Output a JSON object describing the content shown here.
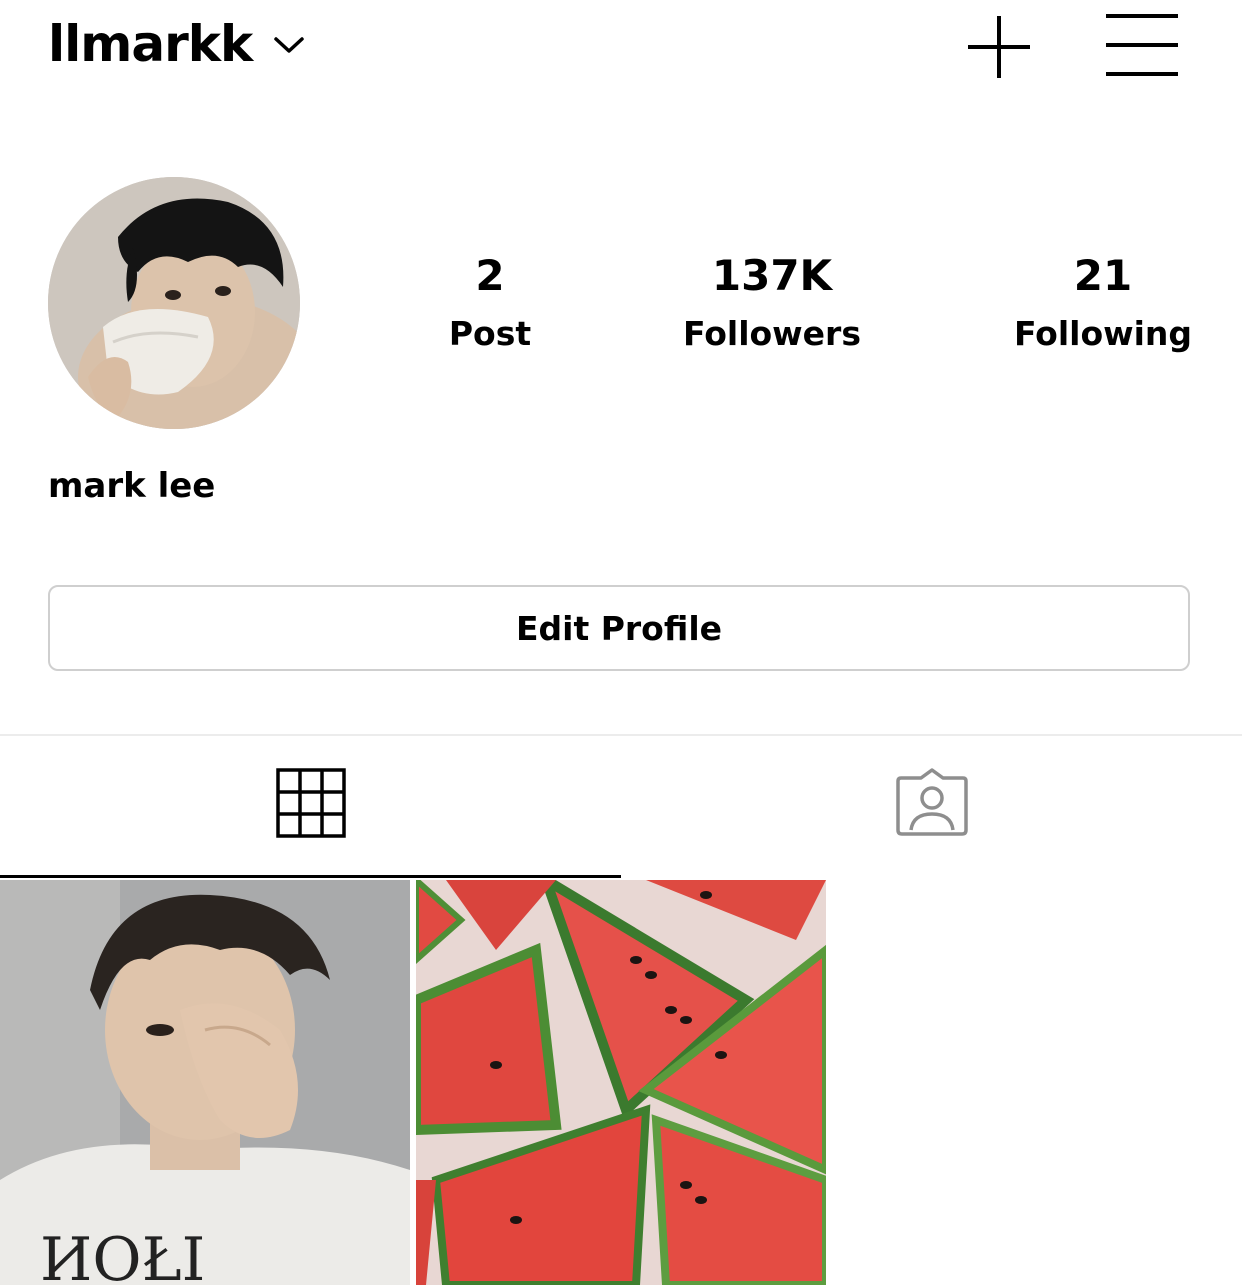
{
  "header": {
    "username": "llmarkk",
    "icons": [
      "chevron-down-icon",
      "plus-icon",
      "menu-icon"
    ]
  },
  "profile": {
    "display_name": "mark lee",
    "stats": {
      "posts": {
        "value": "2",
        "label": "Post"
      },
      "followers": {
        "value": "137K",
        "label": "Followers"
      },
      "following": {
        "value": "21",
        "label": "Following"
      }
    },
    "edit_button_label": "Edit Profile"
  },
  "tabs": [
    {
      "name": "grid",
      "icon": "grid-icon",
      "active": true
    },
    {
      "name": "tagged",
      "icon": "tagged-person-icon",
      "active": false
    }
  ],
  "posts": [
    {
      "description": "photo"
    },
    {
      "description": "photo"
    }
  ]
}
